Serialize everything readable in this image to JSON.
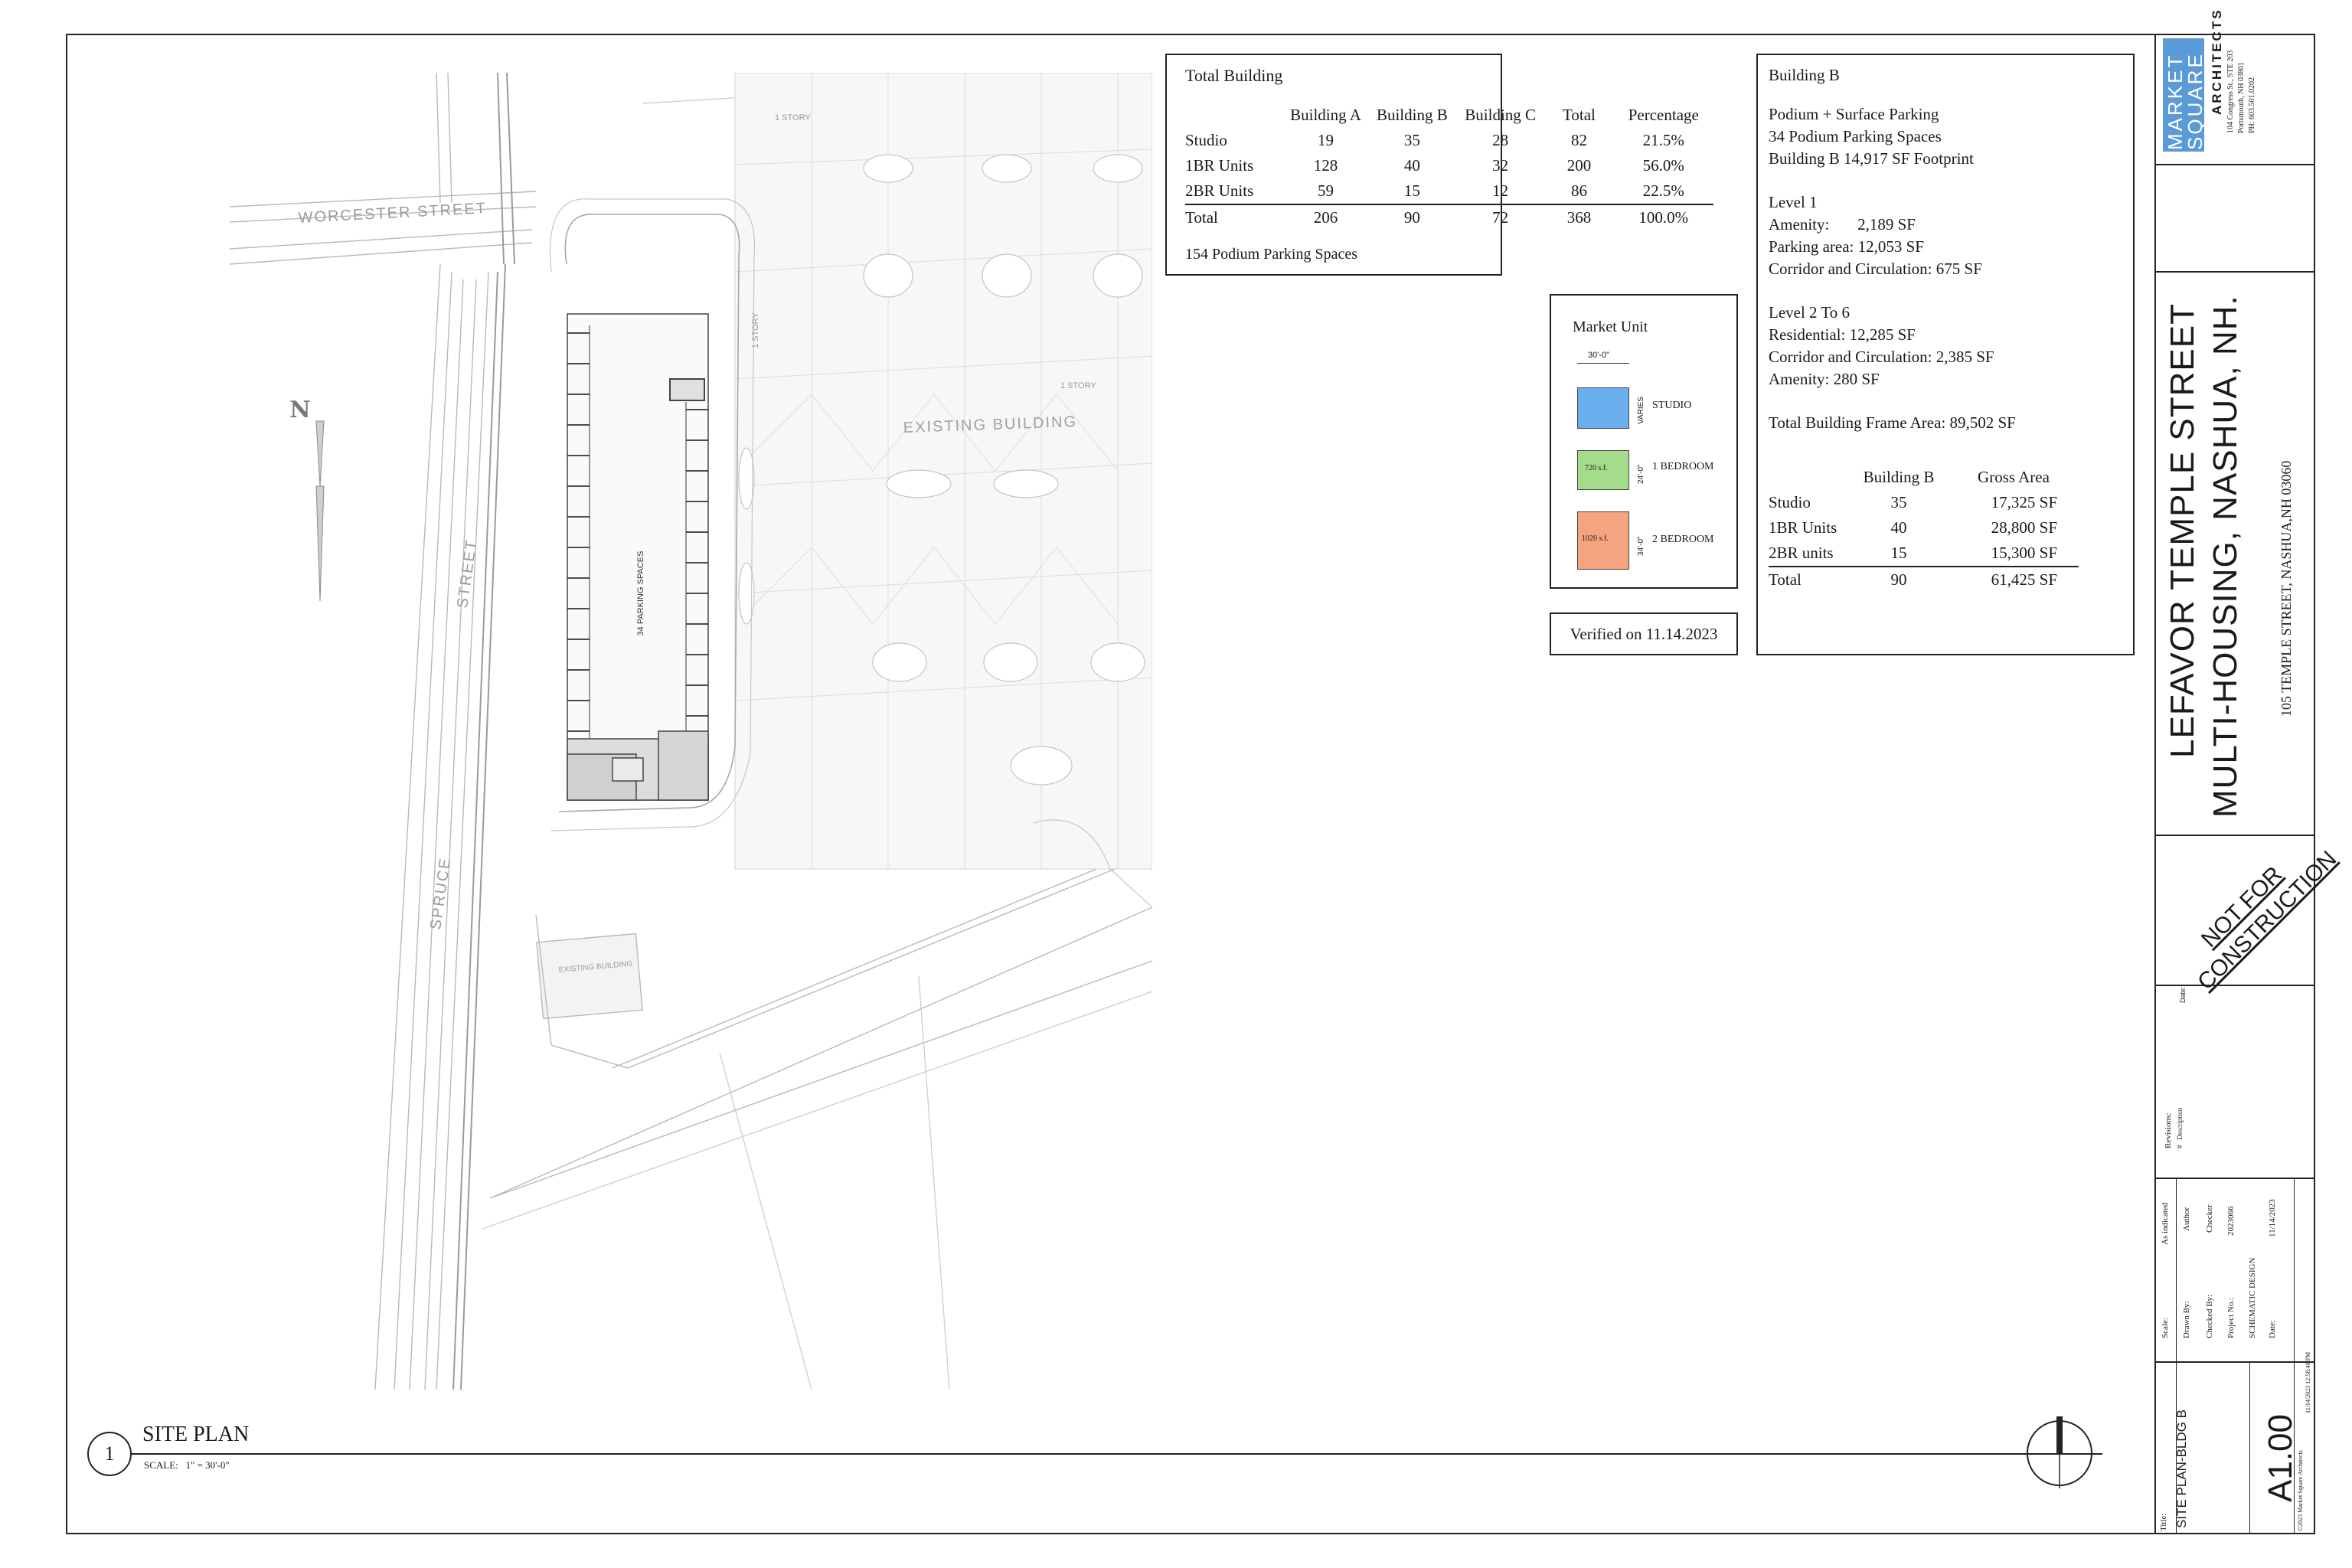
{
  "totals_table": {
    "title": "Total Building",
    "columns": [
      "",
      "Building A",
      "Building B",
      "Building C",
      "Total",
      "Percentage"
    ],
    "rows": [
      [
        "Studio",
        "19",
        "35",
        "28",
        "82",
        "21.5%"
      ],
      [
        "1BR Units",
        "128",
        "40",
        "32",
        "200",
        "56.0%"
      ],
      [
        "2BR Units",
        "59",
        "15",
        "12",
        "86",
        "22.5%"
      ],
      [
        "Total",
        "206",
        "90",
        "72",
        "368",
        "100.0%"
      ]
    ],
    "footnote": "154 Podium Parking Spaces"
  },
  "building_b": {
    "title": "Building B",
    "line1": "Podium + Surface Parking",
    "line2": "34 Podium Parking Spaces",
    "line3": "Building B 14,917 SF Footprint",
    "level1_title": "Level 1",
    "level1_amenity": "Amenity:       2,189 SF",
    "level1_parking": "Parking area: 12,053 SF",
    "level1_corridor": "Corridor and Circulation: 675 SF",
    "level26_title": "Level 2 To 6",
    "level26_residential": "Residential: 12,285 SF",
    "level26_corridor": "Corridor and Circulation: 2,385 SF",
    "level26_amenity": "Amenity: 280 SF",
    "frame_area": "Total Building Frame Area: 89,502 SF",
    "columns": [
      "",
      "Building B",
      "Gross Area"
    ],
    "rows": [
      [
        "Studio",
        "35",
        "17,325 SF"
      ],
      [
        "1BR Units",
        "40",
        "28,800 SF"
      ],
      [
        "2BR units",
        "15",
        "15,300 SF"
      ],
      [
        "Total",
        "90",
        "61,425 SF"
      ]
    ]
  },
  "market_unit": {
    "title": "Market Unit",
    "width_dim": "30'-0\"",
    "units": [
      {
        "label": "STUDIO",
        "color": "#6aaeee",
        "area": "",
        "dim": "VARIES"
      },
      {
        "label": "1 BEDROOM",
        "color": "#a4dc8c",
        "area": "720 s.f.",
        "dim": "24'-0\""
      },
      {
        "label": "2 BEDROOM",
        "color": "#f4a47e",
        "area": "1020 s.f.",
        "dim": "34'-0\""
      }
    ]
  },
  "verified": "Verified on 11.14.2023",
  "drawing": {
    "number": "1",
    "title": "SITE PLAN",
    "scale": "SCALE:   1\" = 30'-0\"",
    "north": "N",
    "parking_label": "34 PARKING SPACES",
    "street_worcester": "WORCESTER STREET",
    "street_spruce": "SPRUCE",
    "street_label": "STREET",
    "existing_building": "EXISTING BUILDING",
    "existing_building_small": "EXISTING BUILDING",
    "story_1": "1 STORY",
    "story_1b": "1 STORY",
    "story_1c": "1 STORY"
  },
  "title_block": {
    "firm_name_1": "MARKET",
    "firm_name_2": "SQUARE",
    "firm_type": "ARCHITECTS",
    "firm_addr1": "104 Congress St., STE 203",
    "firm_addr2": "Portsmouth, NH 03801",
    "firm_phone": "PH: 603.501.0202",
    "project_line1": "LEFAVOR TEMPLE STREET",
    "project_line2": "MULTI-HOUSING, NASHUA, NH.",
    "project_address": "105 TEMPLE STREET, NASHUA,NH 03060",
    "stamp_line1": "NOT FOR",
    "stamp_line2": "CONSTRUCTION",
    "date_label": "Date:",
    "revisions_label": "Revisions:",
    "revisions_desc": "#   Description",
    "scale_label": "Scale:",
    "scale_value": "As indicated",
    "drawn_label": "Drawn By:",
    "drawn_value": "Author",
    "checked_label": "Checked By:",
    "checked_value": "Checker",
    "project_no_label": "Project No.:",
    "project_no_value": "2023066",
    "phase": "SCHEMATIC DESIGN",
    "date2_label": "Date:",
    "date2_value": "11/14/2023",
    "title_label": "Title:",
    "sheet_title": "SITE PLAN-BLDG B",
    "sheet_number": "A1.00",
    "copyright": "©2023 Market Square Architects",
    "print_stamp": "11/14/2023 12:58:40 PM"
  }
}
